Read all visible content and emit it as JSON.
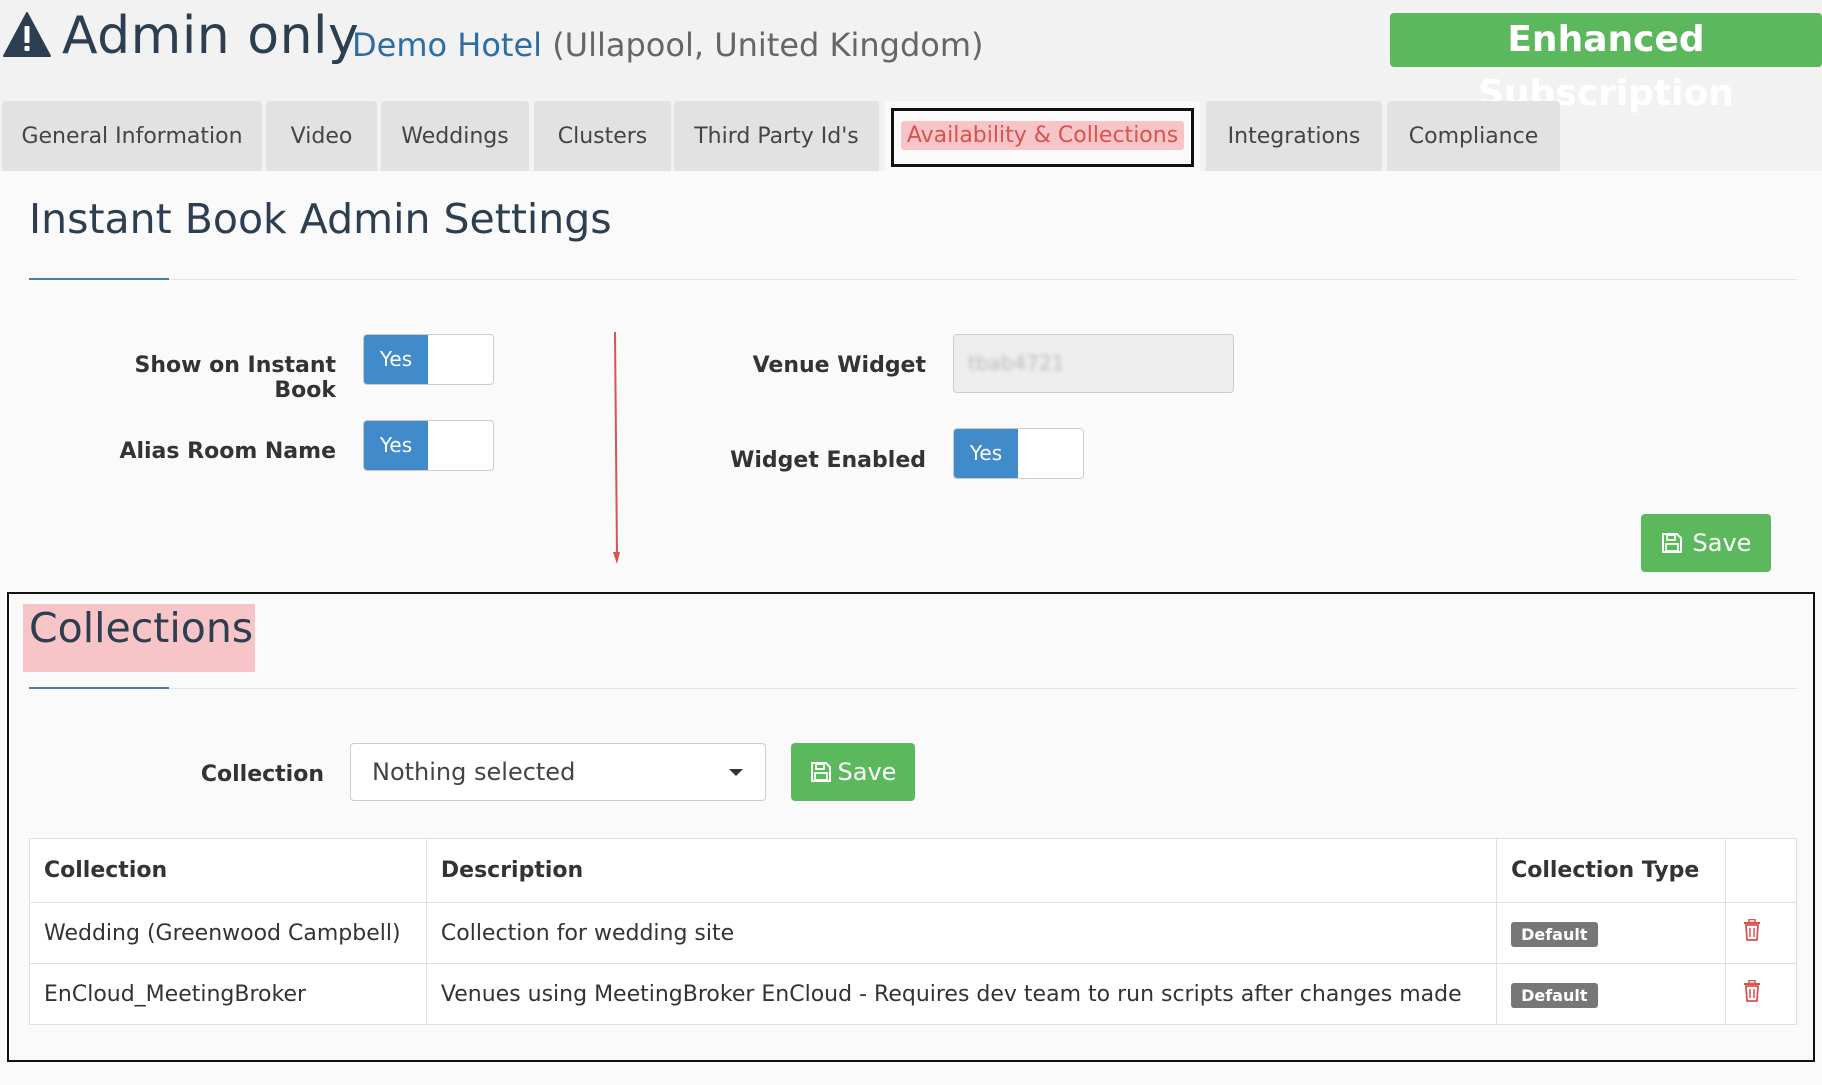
{
  "header": {
    "admin_title": "Admin only",
    "hotel_name": "Demo Hotel",
    "hotel_location": "(Ullapool, United Kingdom)",
    "subscription_badge": "Enhanced Subscription"
  },
  "tabs": [
    {
      "label": "General Information"
    },
    {
      "label": "Video"
    },
    {
      "label": "Weddings"
    },
    {
      "label": "Clusters"
    },
    {
      "label": "Third Party Id's"
    },
    {
      "label": "Availability & Collections",
      "active": true
    },
    {
      "label": "Integrations"
    },
    {
      "label": "Compliance"
    }
  ],
  "instant_book": {
    "title": "Instant Book Admin Settings",
    "show_on_instant_book_label": "Show on Instant Book",
    "show_on_instant_book_value": "Yes",
    "alias_room_name_label": "Alias Room Name",
    "alias_room_name_value": "Yes",
    "venue_widget_label": "Venue Widget",
    "venue_widget_value": "tbab4721",
    "widget_enabled_label": "Widget Enabled",
    "widget_enabled_value": "Yes",
    "save_label": "Save"
  },
  "collections": {
    "title": "Collections",
    "collection_label": "Collection",
    "dropdown_value": "Nothing selected",
    "save_label": "Save",
    "columns": [
      "Collection",
      "Description",
      "Collection Type"
    ],
    "rows": [
      {
        "collection": "Wedding (Greenwood Campbell)",
        "description": "Collection for wedding site",
        "type": "Default"
      },
      {
        "collection": "EnCloud_MeetingBroker",
        "description": "Venues using MeetingBroker EnCloud - Requires dev team to run scripts after changes made",
        "type": "Default"
      }
    ]
  },
  "colors": {
    "accent_blue": "#428bca",
    "success_green": "#5cb85c",
    "danger_red": "#d9534f",
    "highlight_pink": "#f7c5c8"
  },
  "icons": {
    "warning": "warning-triangle-icon",
    "save": "floppy-disk-icon",
    "delete": "trash-icon",
    "dropdown": "caret-down-icon"
  }
}
